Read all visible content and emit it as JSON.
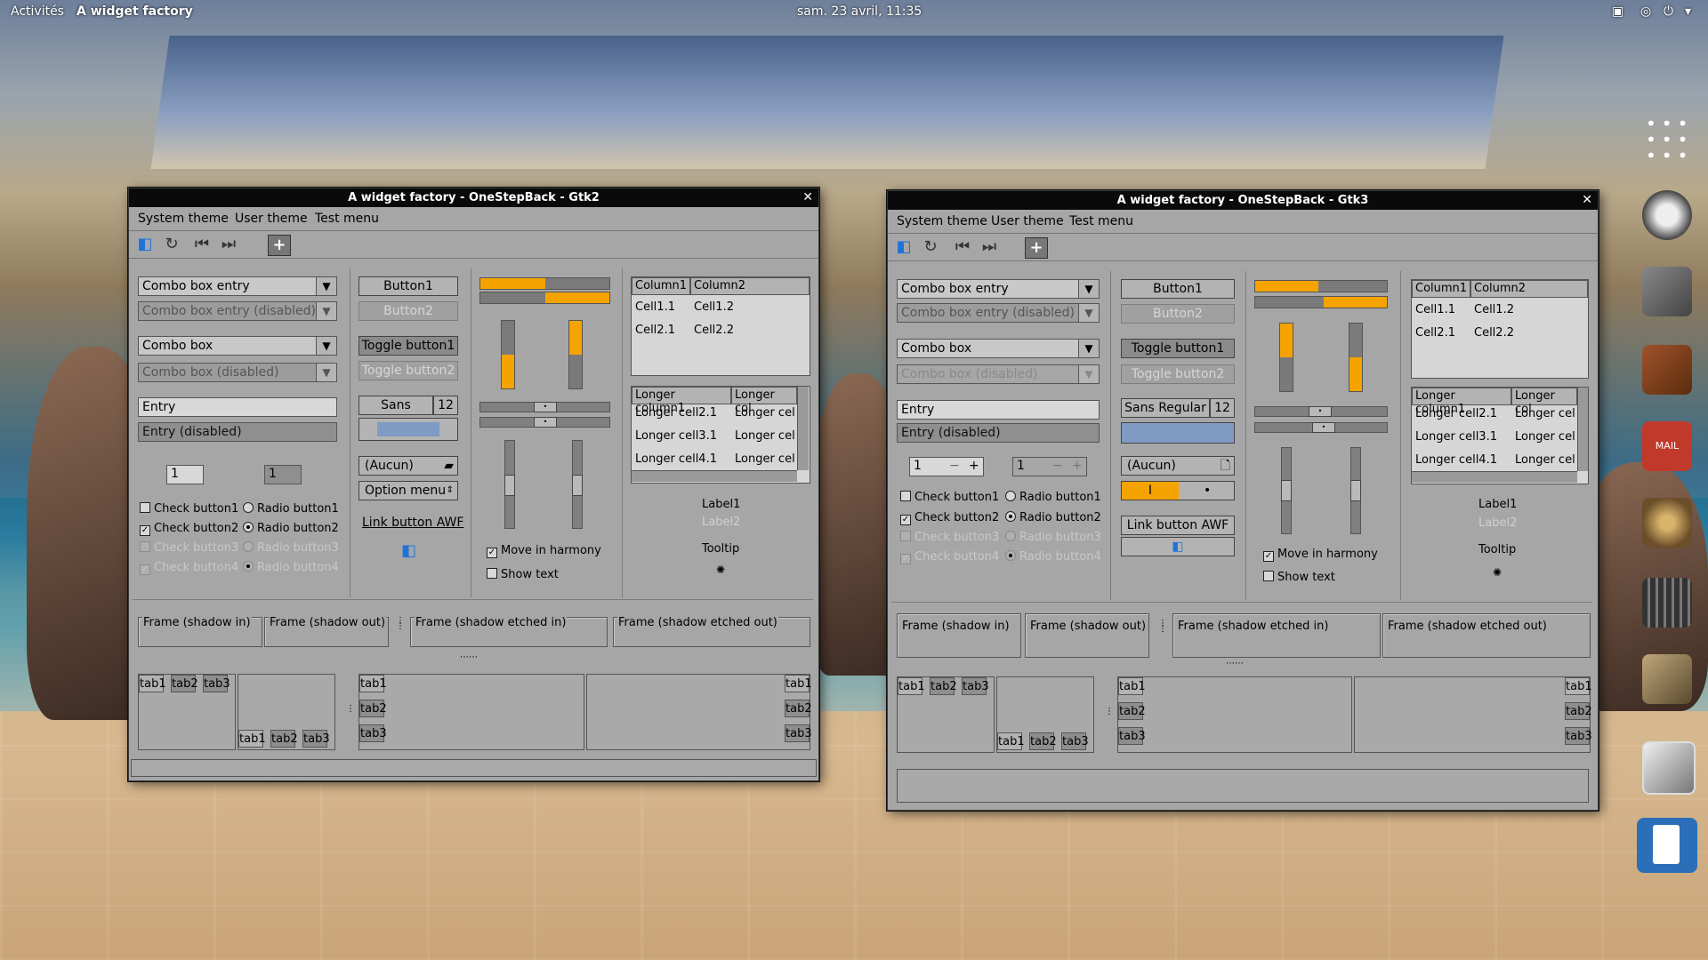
{
  "topbar": {
    "activities": "Activités",
    "app": "A widget factory",
    "clock": "sam. 23 avril, 11:35"
  },
  "gtk2": {
    "title": "A widget factory - OneStepBack - Gtk2",
    "menu": [
      "System theme",
      "User theme",
      "Test menu"
    ],
    "combo_entry": "Combo box entry",
    "combo_entry_dis": "Combo box entry (disabled)",
    "combo": "Combo box",
    "combo_dis": "Combo box (disabled)",
    "entry": "Entry",
    "entry_dis": "Entry (disabled)",
    "spin1": "1",
    "spin2": "1",
    "check1": "Check button1",
    "check2": "Check button2",
    "check3": "Check button3",
    "check4": "Check button4",
    "radio1": "Radio button1",
    "radio2": "Radio button2",
    "radio3": "Radio button3",
    "radio4": "Radio button4",
    "button1": "Button1",
    "button2": "Button2",
    "toggle1": "Toggle button1",
    "toggle2": "Toggle button2",
    "font": "Sans",
    "font_size": "12",
    "file": "(Aucun)",
    "option": "Option menu",
    "link": "Link button AWF",
    "move": "Move in harmony",
    "show": "Show text",
    "col1": "Column1",
    "col2": "Column2",
    "c11": "Cell1.1",
    "c12": "Cell1.2",
    "c21": "Cell2.1",
    "c22": "Cell2.2",
    "lcol1": "Longer column1",
    "lcol2": "Longer col",
    "lc21": "Longer cell2.1",
    "lc31": "Longer cell3.1",
    "lc41": "Longer cell4.1",
    "lcx": "Longer cel",
    "label1": "Label1",
    "label2": "Label2",
    "tooltip": "Tooltip",
    "frame_in": "Frame (shadow in)",
    "frame_out": "Frame (shadow out)",
    "frame_ein": "Frame (shadow etched in)",
    "frame_eout": "Frame (shadow etched out)",
    "tab1": "tab1",
    "tab2": "tab2",
    "tab3": "tab3"
  },
  "gtk3": {
    "title": "A widget factory - OneStepBack - Gtk3",
    "menu": [
      "System theme",
      "User theme",
      "Test menu"
    ],
    "combo_entry": "Combo box entry",
    "combo_entry_dis": "Combo box entry (disabled)",
    "combo": "Combo box",
    "combo_dis": "Combo box (disabled)",
    "entry": "Entry",
    "entry_dis": "Entry (disabled)",
    "spin1": "1",
    "spin2": "1",
    "check1": "Check button1",
    "check2": "Check button2",
    "check3": "Check button3",
    "check4": "Check button4",
    "radio1": "Radio button1",
    "radio2": "Radio button2",
    "radio3": "Radio button3",
    "radio4": "Radio button4",
    "button1": "Button1",
    "button2": "Button2",
    "toggle1": "Toggle button1",
    "toggle2": "Toggle button2",
    "font": "Sans Regular",
    "font_size": "12",
    "file": "(Aucun)",
    "switch_on": "I",
    "link": "Link button AWF",
    "move": "Move in harmony",
    "show": "Show text",
    "col1": "Column1",
    "col2": "Column2",
    "c11": "Cell1.1",
    "c12": "Cell1.2",
    "c21": "Cell2.1",
    "c22": "Cell2.2",
    "lcol1": "Longer column1",
    "lcol2": "Longer col",
    "lc21": "Longer cell2.1",
    "lc31": "Longer cell3.1",
    "lc41": "Longer cell4.1",
    "lcx": "Longer cel",
    "label1": "Label1",
    "label2": "Label2",
    "tooltip": "Tooltip",
    "frame_in": "Frame (shadow in)",
    "frame_out": "Frame (shadow out)",
    "frame_ein": "Frame (shadow etched in)",
    "frame_eout": "Frame (shadow etched out)",
    "tab1": "tab1",
    "tab2": "tab2",
    "tab3": "tab3"
  },
  "dock": {
    "mail_label": "MAIL"
  },
  "colors": {
    "accent": "#f5a300",
    "window_bg": "#a6a6a6",
    "titlebar": "#0a0a0a"
  }
}
